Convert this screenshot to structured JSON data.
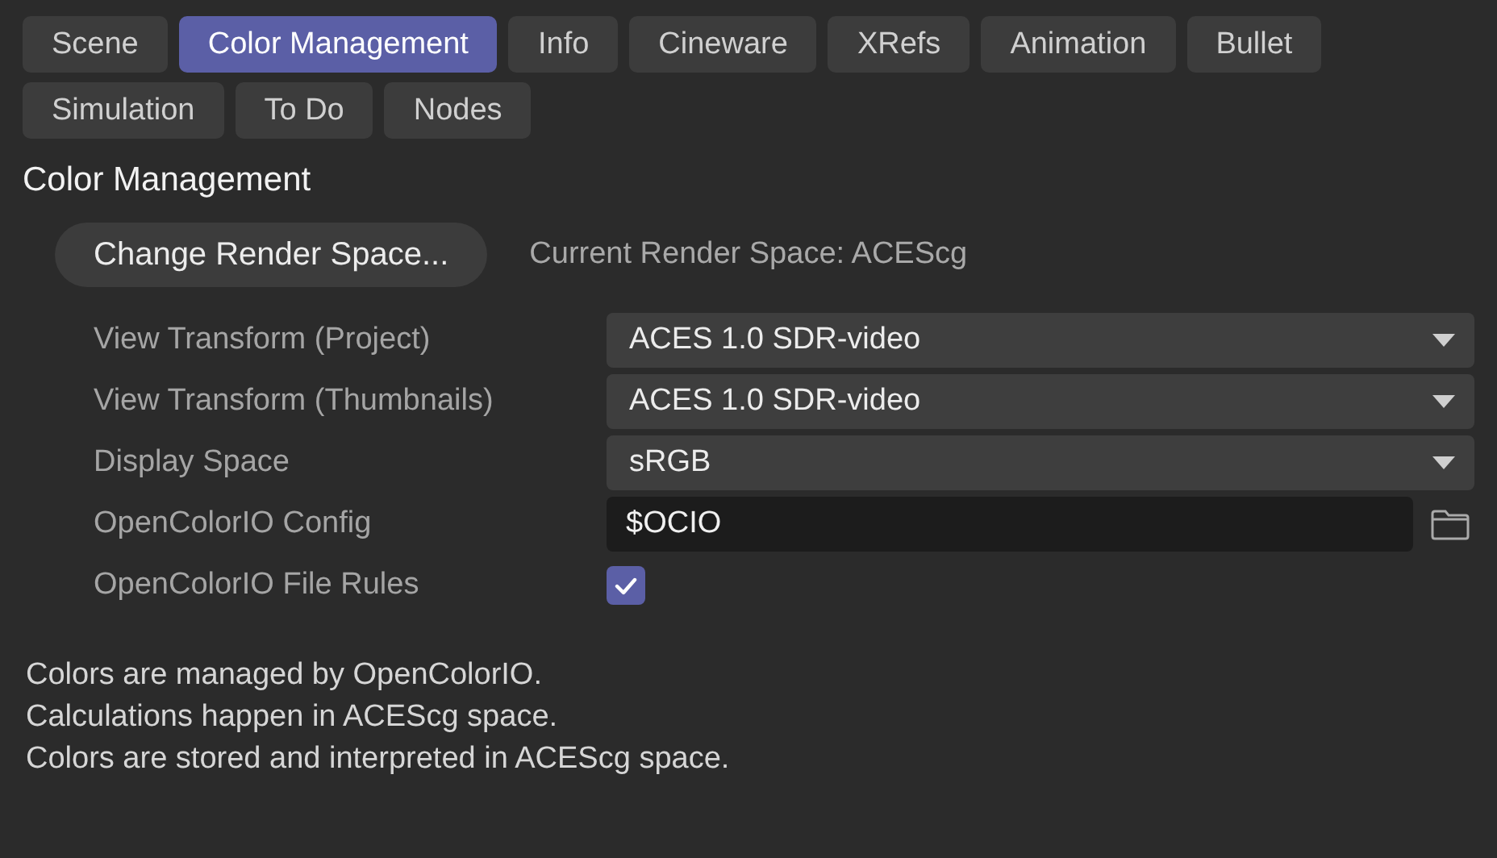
{
  "tabs": [
    {
      "label": "Scene",
      "selected": false
    },
    {
      "label": "Color Management",
      "selected": true
    },
    {
      "label": "Info",
      "selected": false
    },
    {
      "label": "Cineware",
      "selected": false
    },
    {
      "label": "XRefs",
      "selected": false
    },
    {
      "label": "Animation",
      "selected": false
    },
    {
      "label": "Bullet",
      "selected": false
    },
    {
      "label": "Simulation",
      "selected": false
    },
    {
      "label": "To Do",
      "selected": false
    },
    {
      "label": "Nodes",
      "selected": false
    }
  ],
  "section_title": "Color Management",
  "render_space": {
    "button": "Change Render Space...",
    "current": "Current Render Space: ACEScg"
  },
  "settings": [
    {
      "kind": "dropdown",
      "label": "View Transform (Project)",
      "value": "ACES 1.0 SDR-video"
    },
    {
      "kind": "dropdown",
      "label": "View Transform (Thumbnails)",
      "value": "ACES 1.0 SDR-video"
    },
    {
      "kind": "dropdown",
      "label": "Display Space",
      "value": "sRGB"
    },
    {
      "kind": "path",
      "label": "OpenColorIO Config",
      "value": "$OCIO"
    },
    {
      "kind": "checkbox",
      "label": "OpenColorIO File Rules",
      "checked": true
    }
  ],
  "info_lines": [
    "Colors are managed by OpenColorIO.",
    "Calculations happen in ACEScg space.",
    "Colors are stored and interpreted in ACEScg space."
  ]
}
